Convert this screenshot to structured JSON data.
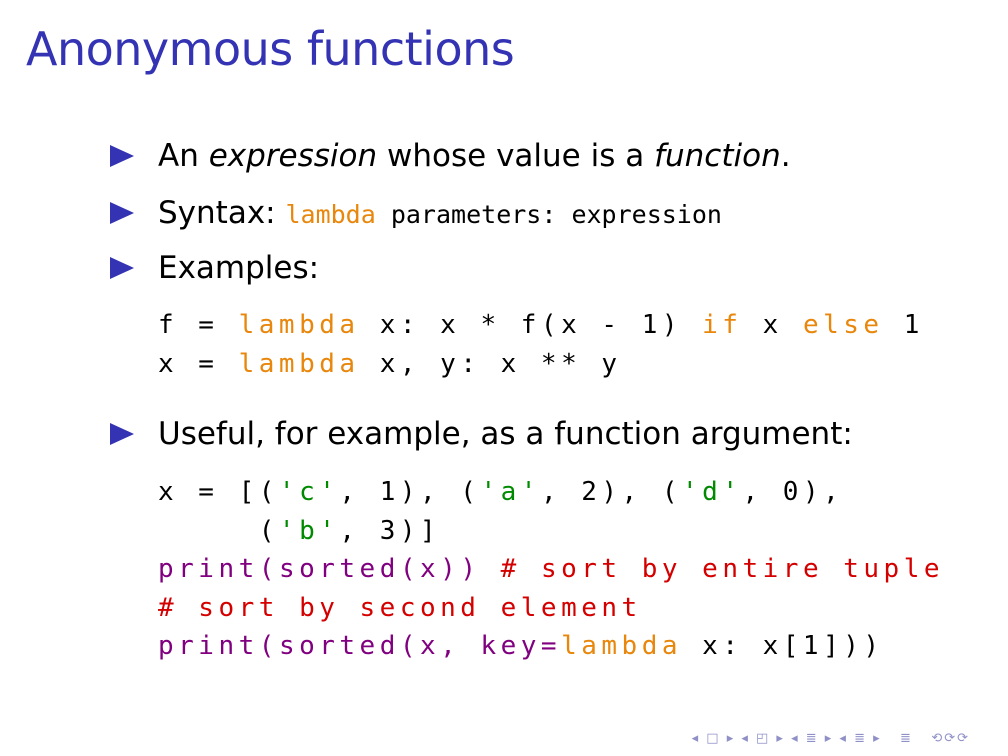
{
  "slide": {
    "title": "Anonymous functions",
    "bullet1": {
      "pre": "An ",
      "em1": "expression",
      "mid": " whose value is a ",
      "em2": "function",
      "post": "."
    },
    "bullet2": {
      "label": "Syntax: ",
      "kw": "lambda",
      "rest": " parameters: expression"
    },
    "bullet3": "Examples:",
    "examples": {
      "line1": {
        "a": "f = ",
        "kw1": "lambda",
        "b": " x: x * f(x - 1) ",
        "kw2": "if",
        "c": " x ",
        "kw3": "else",
        "d": " 1"
      },
      "line2": {
        "a": "x = ",
        "kw1": "lambda",
        "b": " x, y: x ** y"
      }
    },
    "bullet4": "Useful, for example, as a function argument:",
    "code2": {
      "line1": {
        "a": "x = [(",
        "s1": "'c'",
        "b": ", 1), (",
        "s2": "'a'",
        "c": ", 2), (",
        "s3": "'d'",
        "d": ", 0),"
      },
      "line2": {
        "a": "     (",
        "s1": "'b'",
        "b": ", 3)]"
      },
      "line3": {
        "p": "print",
        "a": "(",
        "s": "sorted",
        "b": "(x)) ",
        "cm": "# sort by entire tuple"
      },
      "line4": {
        "cm": "# sort by second element"
      },
      "line5": {
        "p": "print",
        "a": "(",
        "s": "sorted",
        "b": "(x, key=",
        "kw": "lambda",
        "c": " x: x[1]))"
      }
    },
    "nav_symbols": "◂ □ ▸ ◂ ◰ ▸ ◂ ≣ ▸ ◂ ≣ ▸   ≣   ⟲⟳⟳"
  },
  "colors": {
    "title": "#3333b3",
    "keyword": "#e8870c",
    "string": "#008a00",
    "builtin": "#800080",
    "comment": "#d40000"
  }
}
